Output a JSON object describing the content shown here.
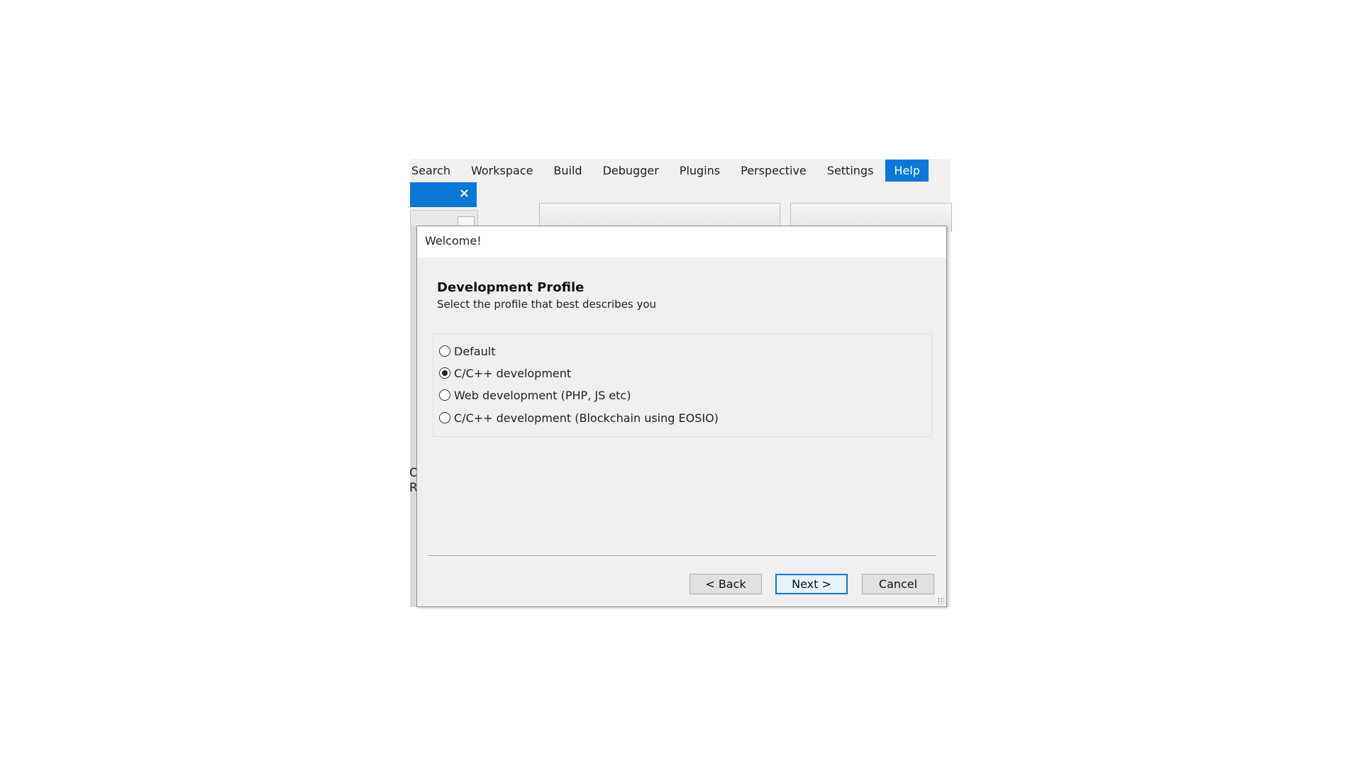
{
  "menubar": {
    "items": [
      {
        "label": "Search"
      },
      {
        "label": "Workspace"
      },
      {
        "label": "Build"
      },
      {
        "label": "Debugger"
      },
      {
        "label": "Plugins"
      },
      {
        "label": "Perspective"
      },
      {
        "label": "Settings"
      },
      {
        "label": "Help",
        "active": true
      }
    ]
  },
  "tab": {
    "close_icon": "×"
  },
  "background": {
    "left_fragments": [
      "O",
      "R"
    ]
  },
  "dialog": {
    "title": "Welcome!",
    "heading": "Development Profile",
    "subheading": "Select the profile that best describes you",
    "options": [
      {
        "label": "Default",
        "checked": false
      },
      {
        "label": "C/C++ development",
        "checked": true
      },
      {
        "label": "Web development (PHP, JS etc)",
        "checked": false
      },
      {
        "label": "C/C++ development (Blockchain using EOSIO)",
        "checked": false
      }
    ],
    "buttons": {
      "back": "< Back",
      "next": "Next >",
      "cancel": "Cancel"
    }
  },
  "colors": {
    "accent": "#0a78d7",
    "dialog_bg": "#efefef",
    "title_bg": "#ffffff"
  }
}
